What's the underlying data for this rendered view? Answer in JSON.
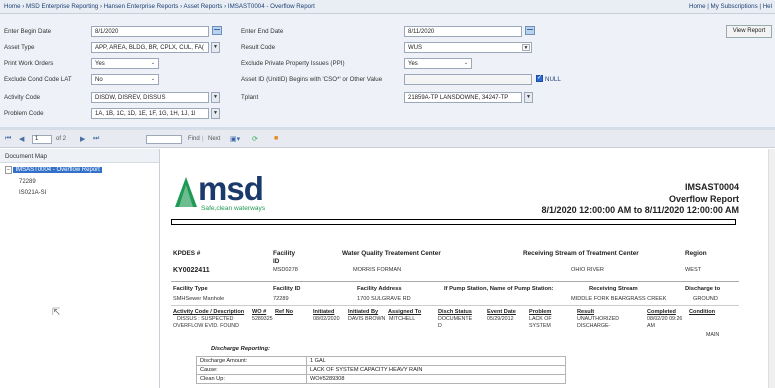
{
  "header": {
    "breadcrumb": "Home › MSD Enterprise Reporting › Hansen Enterprise Reports › Asset Reports › IMSAST0004 - Overflow Report",
    "right_links": "Home | My Subscriptions | Hel"
  },
  "params": {
    "begin_date_label": "Enter Begin Date",
    "begin_date": "8/1/2020",
    "end_date_label": "Enter End Date",
    "end_date": "8/11/2020",
    "asset_type_label": "Asset Type",
    "asset_type": "APP, AREA, BLDG, BR, CPLX, CUL, FA(",
    "result_code_label": "Result Code",
    "result_code": "WUS",
    "print_work_orders_label": "Print Work Orders",
    "print_work_orders": "Yes",
    "exclude_ppi_label": "Exclude Private Property Issues (PPI)",
    "exclude_ppi": "Yes",
    "exclude_cond_label": "Exclude Cond Code LAT",
    "exclude_cond": "No",
    "asset_id_label": "Asset ID (UnitID) Begins with 'CSO*' or Other Value",
    "asset_id": "",
    "null_label": "NULL",
    "activity_code_label": "Activity Code",
    "activity_code": "DISDW, DISREV, DISSUS",
    "tplant_label": "Tplant",
    "tplant": "21859A-TP LANSDOWNE, 34247-TP",
    "problem_code_label": "Problem Code",
    "problem_code": "1A, 1B, 1C, 1D, 1E, 1F, 1G, 1H, 1J, 1l",
    "view_report": "View Report"
  },
  "toolbar": {
    "page": "1",
    "of_pages": "of 2",
    "find": "Find",
    "next": "Next"
  },
  "docmap": {
    "title": "Document Map",
    "root": "IMSAST0004 - Overflow Report",
    "children": [
      "72289",
      "IS021A-SI"
    ]
  },
  "report": {
    "logo_text": "msd",
    "logo_tagline": "Safe,clean waterways",
    "report_id": "IMSAST0004",
    "report_name": "Overflow Report",
    "date_range": "8/1/2020 12:00:00 AM to 8/11/2020 12:00:00 AM",
    "h1": {
      "kpdes": "KPDES #",
      "facility": "Facility",
      "facility2": "ID",
      "wqtc": "Water Quality Treatement Center",
      "stream": "Receiving Stream of Treatment Center",
      "region": "Region"
    },
    "r1": {
      "kpdes": "KY0022411",
      "facility": "MSD0278",
      "wqtc": "MORRIS FORMAN",
      "stream": "OHIO RIVER",
      "region": "WEST"
    },
    "h2": {
      "facility_type": "Facility Type",
      "facility_id": "Facility ID",
      "facility_address": "Facility Address",
      "pump_station": "If Pump Station, Name of Pump Station:",
      "receiving_stream": "Receiving Stream",
      "discharge_to": "Discharge to"
    },
    "r2": {
      "facility_type": "SMHSewer Manhole",
      "facility_id": "72289",
      "facility_address": "1700  SULGRAVE RD",
      "receiving_stream": "MIDDLE FORK BEARGRASS CREEK",
      "discharge_to": "GROUND"
    },
    "h3": {
      "activity": "Activity Code / Description",
      "wo": "WO #",
      "ref": "Ref No",
      "initiated": "Initiated",
      "initiated_by": "Initiated By",
      "assigned_to": "Assigned To",
      "disch_status": "Disch Status",
      "event_date": "Event Date",
      "problem": "Problem",
      "result": "Result",
      "completed": "Completed",
      "condition": "Condition"
    },
    "r3": {
      "activity_l1": "DISSUS : SUSPECTED",
      "activity_l2": "OVERFLOW EVID. FOUND",
      "wo": "5289325",
      "initiated": "08/02/2020",
      "initiated_by": "DAVIS BROWN",
      "assigned_to": "MITCHELL",
      "disch_l1": "DOCUMENTE",
      "disch_l2": "D",
      "event_date": "05/29/2012",
      "problem_l1": "LACK OF",
      "problem_l2": "SYSTEM",
      "result_l1": "UNAUTHORIZED",
      "result_l2": "DISCHARGE-",
      "completed_l1": "08/02/20 09:26",
      "completed_l2": "AM",
      "condition": "MAIN"
    },
    "discharge_heading": "Discharge Reporting:",
    "discharge_rows": [
      {
        "label": "Discharge Amount:",
        "value": "1 GAL"
      },
      {
        "label": "Cause:",
        "value": "LACK OF SYSTEM CAPACITY HEAVY RAIN"
      },
      {
        "label": "Clean Up:",
        "value": "WO#5289308"
      }
    ]
  }
}
